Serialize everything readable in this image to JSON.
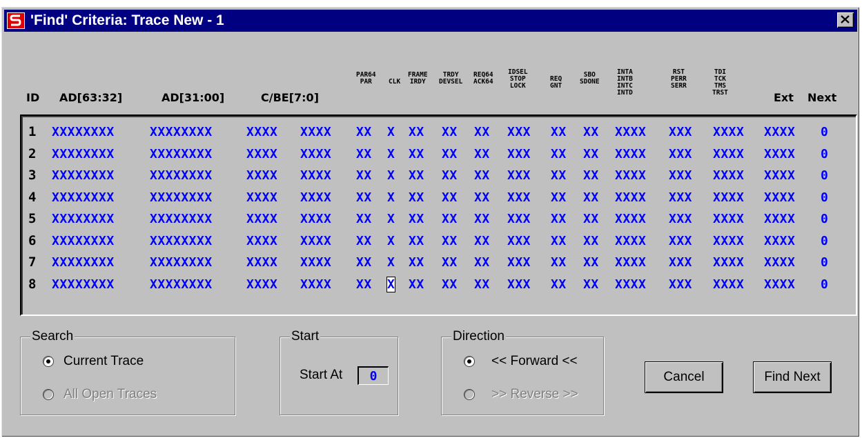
{
  "window": {
    "title": "'Find' Criteria: Trace New - 1"
  },
  "columns": {
    "id": "ID",
    "ad_high": "AD[63:32]",
    "ad_low": "AD[31:00]",
    "cbe": "C/BE[7:0]",
    "par": [
      "PAR64",
      "PAR"
    ],
    "clk": [
      "CLK"
    ],
    "frame": [
      "FRAME",
      "IRDY"
    ],
    "trdy": [
      "TRDY",
      "DEVSEL"
    ],
    "req64": [
      "REQ64",
      "ACK64"
    ],
    "idsel": [
      "IDSEL",
      "STOP",
      "LOCK"
    ],
    "req": [
      "REQ",
      "GNT"
    ],
    "sbo": [
      "SBO",
      "SDONE"
    ],
    "inta": [
      "INTA",
      "INTB",
      "INTC",
      "INTD"
    ],
    "rst": [
      "RST",
      "PERR",
      "SERR"
    ],
    "tdi": [
      "TDI",
      "TCK",
      "TMS",
      "TRST"
    ],
    "ext": "Ext",
    "next": "Next"
  },
  "rows": [
    {
      "id": "1",
      "cells": [
        "XXXXXXXX",
        "XXXXXXXX",
        "XXXX",
        "XXXX",
        "XX",
        "X",
        "XX",
        "XX",
        "XX",
        "XXX",
        "XX",
        "XX",
        "XXXX",
        "XXX",
        "XXXX",
        "XXXX",
        "0"
      ]
    },
    {
      "id": "2",
      "cells": [
        "XXXXXXXX",
        "XXXXXXXX",
        "XXXX",
        "XXXX",
        "XX",
        "X",
        "XX",
        "XX",
        "XX",
        "XXX",
        "XX",
        "XX",
        "XXXX",
        "XXX",
        "XXXX",
        "XXXX",
        "0"
      ]
    },
    {
      "id": "3",
      "cells": [
        "XXXXXXXX",
        "XXXXXXXX",
        "XXXX",
        "XXXX",
        "XX",
        "X",
        "XX",
        "XX",
        "XX",
        "XXX",
        "XX",
        "XX",
        "XXXX",
        "XXX",
        "XXXX",
        "XXXX",
        "0"
      ]
    },
    {
      "id": "4",
      "cells": [
        "XXXXXXXX",
        "XXXXXXXX",
        "XXXX",
        "XXXX",
        "XX",
        "X",
        "XX",
        "XX",
        "XX",
        "XXX",
        "XX",
        "XX",
        "XXXX",
        "XXX",
        "XXXX",
        "XXXX",
        "0"
      ]
    },
    {
      "id": "5",
      "cells": [
        "XXXXXXXX",
        "XXXXXXXX",
        "XXXX",
        "XXXX",
        "XX",
        "X",
        "XX",
        "XX",
        "XX",
        "XXX",
        "XX",
        "XX",
        "XXXX",
        "XXX",
        "XXXX",
        "XXXX",
        "0"
      ]
    },
    {
      "id": "6",
      "cells": [
        "XXXXXXXX",
        "XXXXXXXX",
        "XXXX",
        "XXXX",
        "XX",
        "X",
        "XX",
        "XX",
        "XX",
        "XXX",
        "XX",
        "XX",
        "XXXX",
        "XXX",
        "XXXX",
        "XXXX",
        "0"
      ]
    },
    {
      "id": "7",
      "cells": [
        "XXXXXXXX",
        "XXXXXXXX",
        "XXXX",
        "XXXX",
        "XX",
        "X",
        "XX",
        "XX",
        "XX",
        "XXX",
        "XX",
        "XX",
        "XXXX",
        "XXX",
        "XXXX",
        "XXXX",
        "0"
      ]
    },
    {
      "id": "8",
      "cells": [
        "XXXXXXXX",
        "XXXXXXXX",
        "XXXX",
        "XXXX",
        "XX",
        "X",
        "XX",
        "XX",
        "XX",
        "XXX",
        "XX",
        "XX",
        "XXXX",
        "XXX",
        "XXXX",
        "XXXX",
        "0"
      ]
    }
  ],
  "selected_cell": {
    "row": "8",
    "column": "CLK"
  },
  "search": {
    "label": "Search",
    "current_trace": "Current Trace",
    "all_open_traces": "All Open Traces",
    "selected": "Current Trace"
  },
  "start": {
    "label": "Start",
    "start_at_label": "Start At",
    "start_at_value": "0"
  },
  "direction": {
    "label": "Direction",
    "forward": "<< Forward <<",
    "reverse": ">> Reverse >>",
    "selected": "<< Forward <<"
  },
  "buttons": {
    "cancel": "Cancel",
    "find_next": "Find Next"
  },
  "icons": {
    "app": "app-logo-icon",
    "close": "close-icon"
  },
  "colors": {
    "titlebar": "#000080",
    "cell_text": "#0000ff",
    "window": "#c0c0c0"
  }
}
